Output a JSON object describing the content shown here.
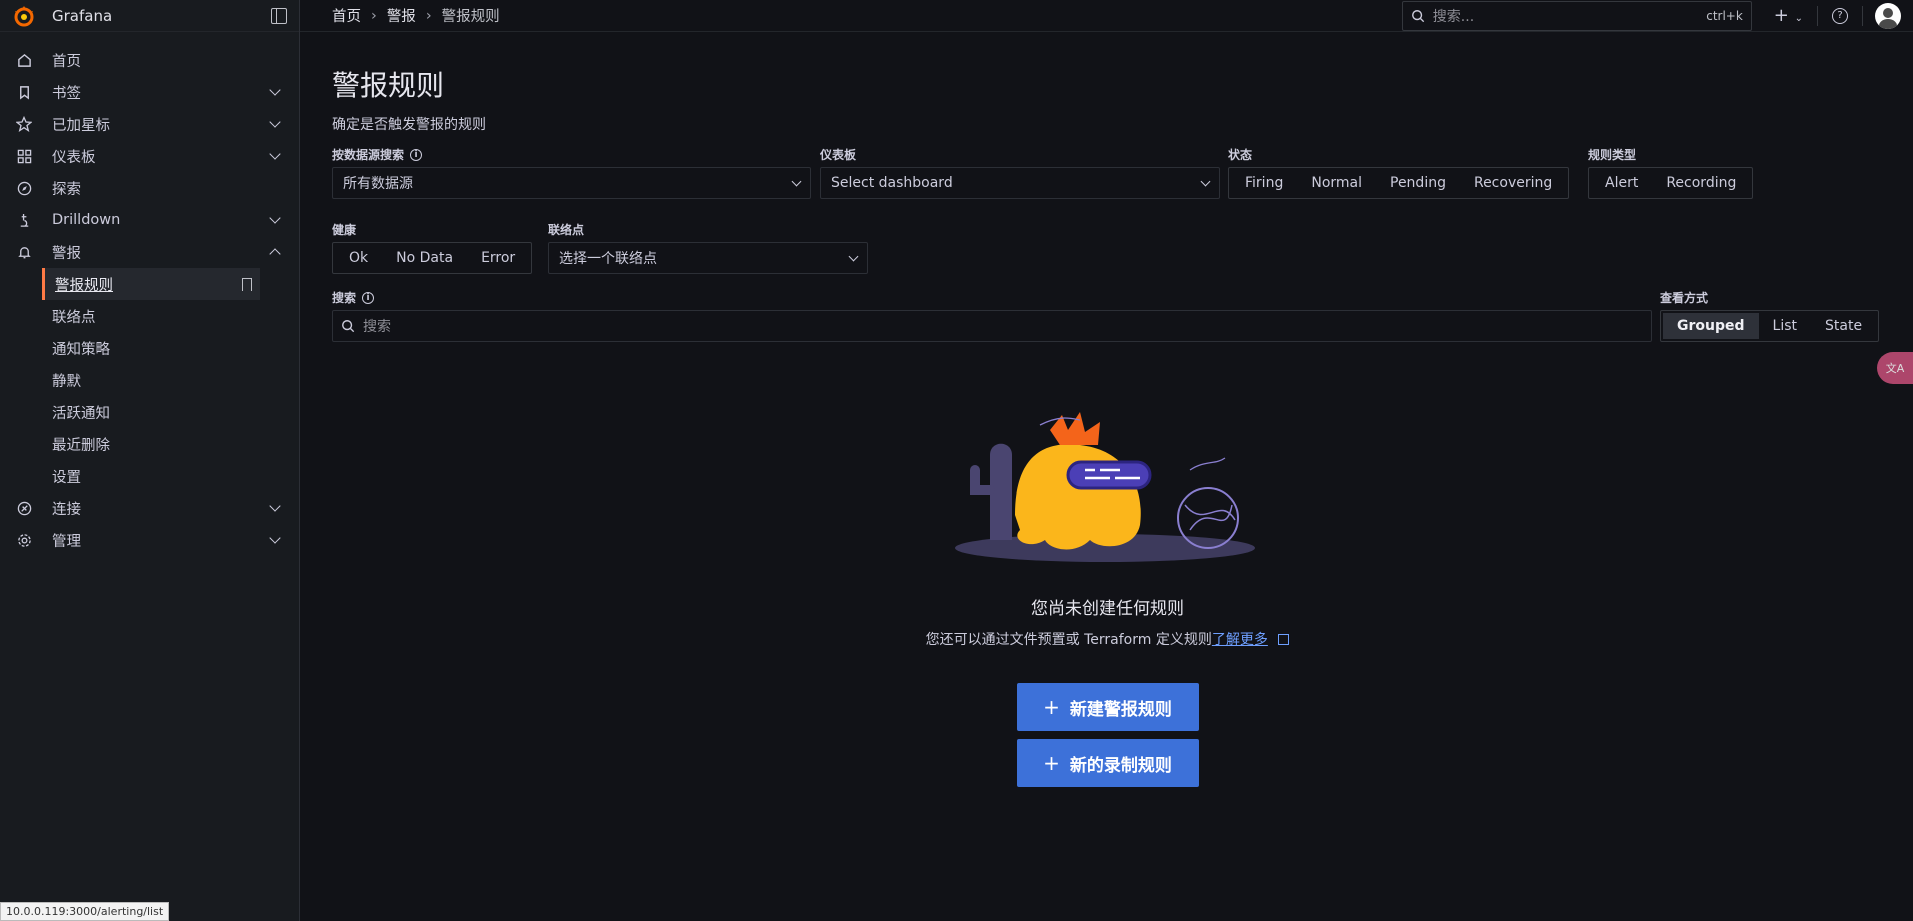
{
  "app": {
    "brand": "Grafana"
  },
  "sidebar": {
    "items": [
      {
        "label": "首页",
        "icon": "home-icon"
      },
      {
        "label": "书签",
        "icon": "bookmark-icon"
      },
      {
        "label": "已加星标",
        "icon": "star-icon"
      },
      {
        "label": "仪表板",
        "icon": "dashboards-icon"
      },
      {
        "label": "探索",
        "icon": "compass-icon"
      },
      {
        "label": "Drilldown",
        "icon": "drilldown-icon"
      },
      {
        "label": "警报",
        "icon": "bell-icon"
      }
    ],
    "alert_sub": [
      "警报规则",
      "联络点",
      "通知策略",
      "静默",
      "活跃通知",
      "最近删除",
      "设置"
    ],
    "bottom": [
      {
        "label": "连接",
        "icon": "connections-icon"
      },
      {
        "label": "管理",
        "icon": "cog-icon"
      }
    ]
  },
  "breadcrumb": [
    "首页",
    "警报",
    "警报规则"
  ],
  "topbar": {
    "search_placeholder": "搜索...",
    "shortcut": "ctrl+k"
  },
  "page": {
    "title": "警报规则",
    "subtitle": "确定是否触发警报的规则"
  },
  "filters": {
    "datasource_label": "按数据源搜索",
    "datasource_value": "所有数据源",
    "dashboard_label": "仪表板",
    "dashboard_value": "Select dashboard",
    "state_label": "状态",
    "state_options": [
      "Firing",
      "Normal",
      "Pending",
      "Recovering"
    ],
    "ruletype_label": "规则类型",
    "ruletype_options": [
      "Alert",
      "Recording"
    ],
    "health_label": "健康",
    "health_options": [
      "Ok",
      "No Data",
      "Error"
    ],
    "contact_label": "联络点",
    "contact_value": "选择一个联络点",
    "search_label": "搜索",
    "search_placeholder": "搜索",
    "view_label": "查看方式",
    "view_options": [
      "Grouped",
      "List",
      "State"
    ],
    "view_selected": "Grouped"
  },
  "empty": {
    "title": "您尚未创建任何规则",
    "sub": "您还可以通过文件预置或 Terraform 定义规则",
    "link": "了解更多",
    "new_alert": "新建警报规则",
    "new_recording": "新的录制规则"
  },
  "status_url": "10.0.0.119:3000/alerting/list",
  "translate_badge": "文A",
  "colors": {
    "accent": "#ff7a45",
    "primary": "#3d71d9",
    "bg": "#111217"
  }
}
